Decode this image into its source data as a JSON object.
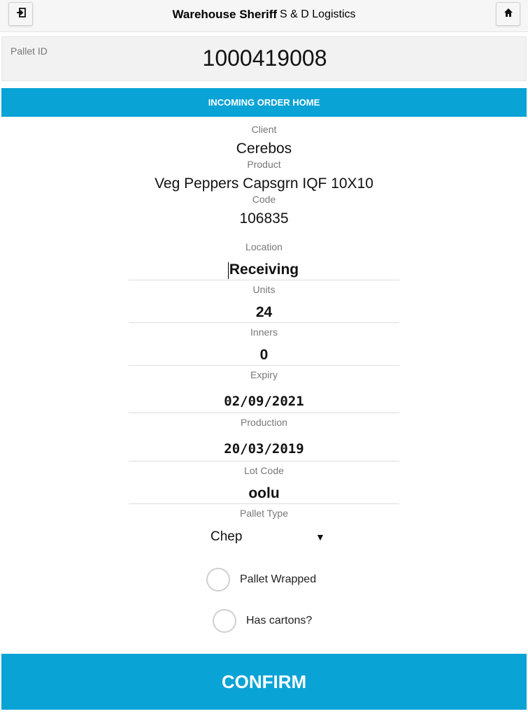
{
  "header": {
    "app_name": "Warehouse Sheriff",
    "company": "S & D Logistics",
    "left_icon": "logout-icon",
    "right_icon": "home-icon"
  },
  "pallet": {
    "label": "Pallet ID",
    "value": "1000419008"
  },
  "banner": "INCOMING ORDER HOME",
  "info": {
    "client_label": "Client",
    "client_value": "Cerebos",
    "product_label": "Product",
    "product_value": "Veg Peppers Capsgrn IQF 10X10",
    "code_label": "Code",
    "code_value": "106835"
  },
  "form": {
    "location_label": "Location",
    "location_value": "Receiving",
    "units_label": "Units",
    "units_value": "24",
    "inners_label": "Inners",
    "inners_value": "0",
    "expiry_label": "Expiry",
    "expiry_value": "02/09/2021",
    "production_label": "Production",
    "production_value": "20/03/2019",
    "lot_label": "Lot Code",
    "lot_value": "oolu",
    "pallet_type_label": "Pallet Type",
    "pallet_type_value": "Chep",
    "pallet_wrapped_label": "Pallet Wrapped",
    "has_cartons_label": "Has cartons?"
  },
  "confirm_label": "CONFIRM",
  "colors": {
    "accent": "#0aa3d6",
    "header_bg": "#f6f6f6",
    "pallet_bg": "#f2f2f2"
  }
}
